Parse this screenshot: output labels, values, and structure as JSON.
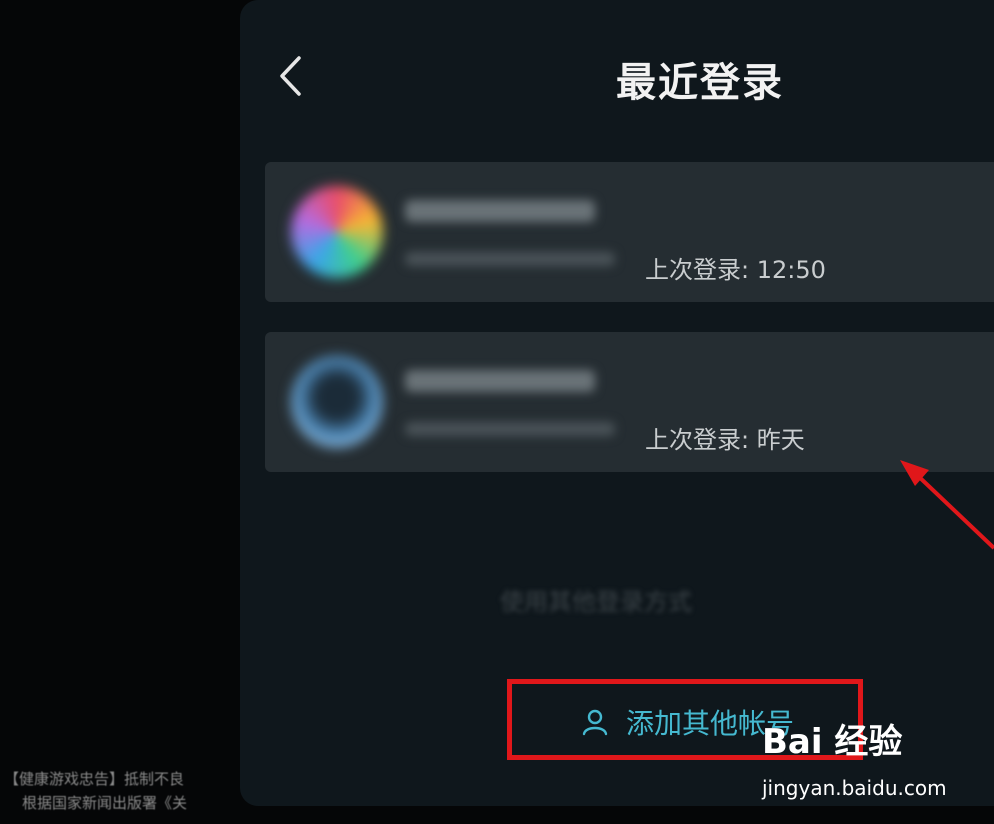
{
  "header": {
    "title": "最近登录"
  },
  "accounts": [
    {
      "last_login": "上次登录: 12:50"
    },
    {
      "last_login": "上次登录: 昨天"
    }
  ],
  "other_login_text": "使用其他登录方式",
  "add_account_label": "添加其他帐号",
  "background_notice": {
    "line1": "【健康游戏忠告】抵制不良",
    "line2": "根据国家新闻出版署《关"
  },
  "watermark": {
    "brand": "Bai 经验",
    "url": "jingyan.baidu.com"
  },
  "colors": {
    "panel": "#0f171c",
    "card": "#252d32",
    "accent": "#45b9d0",
    "annotation": "#e0171a"
  }
}
